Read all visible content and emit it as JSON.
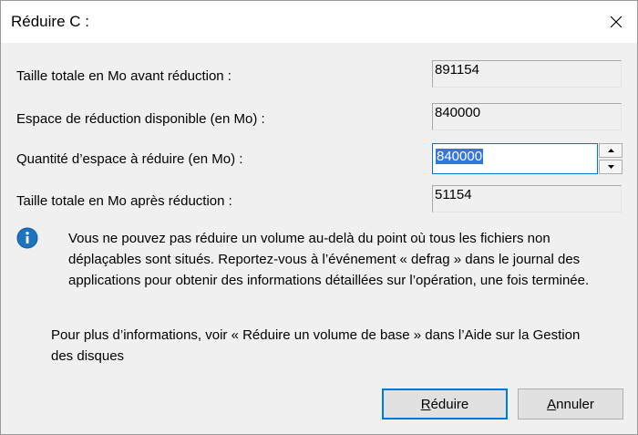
{
  "window": {
    "title": "Réduire C :",
    "close_icon": "close-icon"
  },
  "fields": {
    "total_before": {
      "label": "Taille totale en Mo avant réduction :",
      "value": "891154"
    },
    "available_shrink": {
      "label": "Espace de réduction disponible (en Mo) :",
      "value": "840000"
    },
    "amount_to_shrink": {
      "label": "Quantité d’espace à réduire (en Mo) :",
      "value": "840000"
    },
    "total_after": {
      "label": "Taille totale en Mo après réduction :",
      "value": "51154"
    }
  },
  "info": {
    "icon": "info-icon",
    "text": "Vous ne pouvez pas réduire un volume au-delà du point où tous les fichiers non déplaçables sont situés. Reportez-vous à l’événement « defrag » dans le journal des applications pour obtenir des informations détaillées sur l’opération, une fois terminée."
  },
  "help": {
    "text": "Pour plus d’informations, voir « Réduire un volume de base » dans l’Aide sur la Gestion des disques"
  },
  "buttons": {
    "shrink": {
      "mnemonic": "R",
      "rest": "éduire"
    },
    "cancel": {
      "mnemonic": "A",
      "rest": "nnuler"
    }
  },
  "colors": {
    "accent": "#0078d7",
    "selection": "#3377dd",
    "info_icon": "#1e73be"
  }
}
